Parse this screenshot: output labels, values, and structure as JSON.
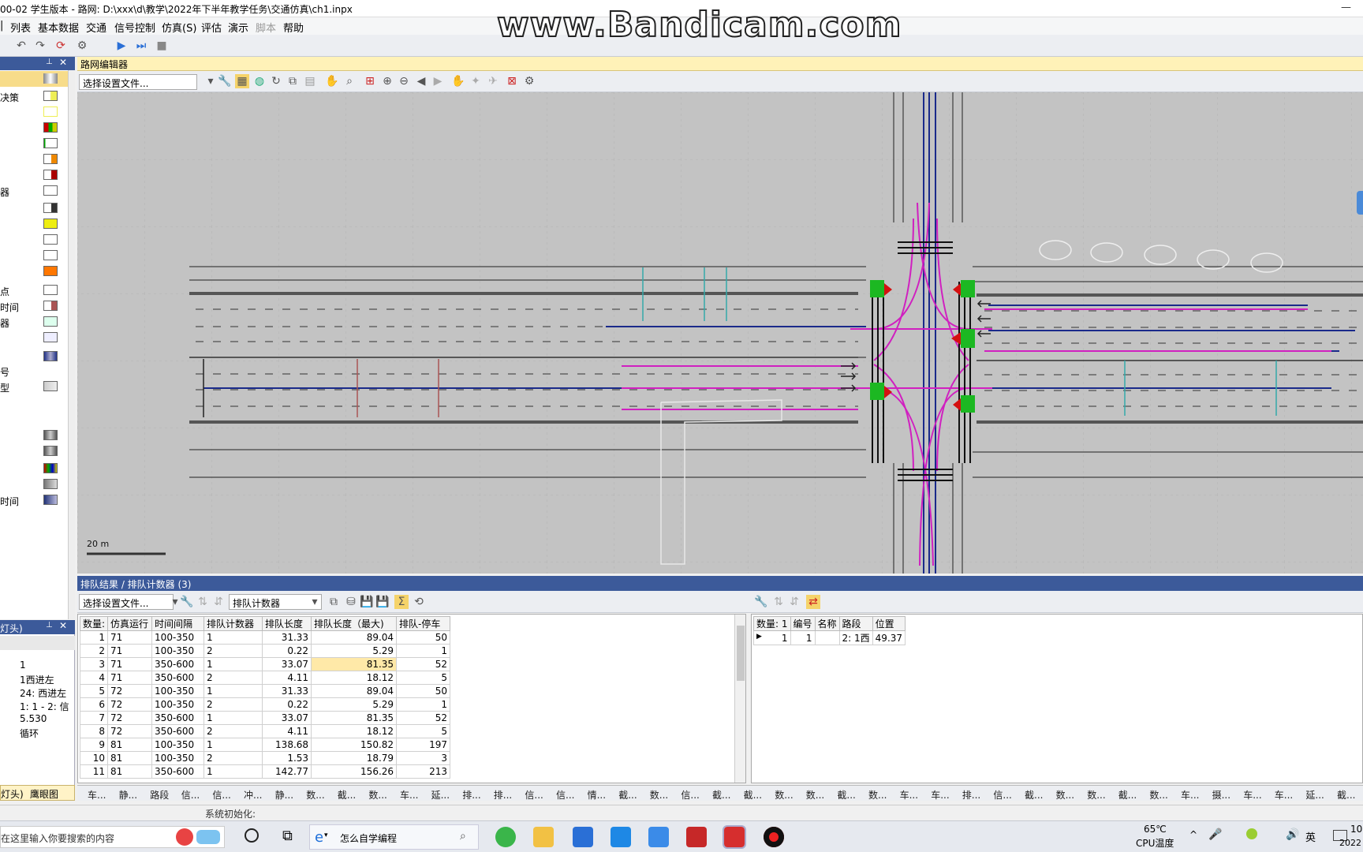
{
  "app": {
    "title": "00-02 学生版本 - 路网: D:\\xxx\\d\\教学\\2022年下半年教学任务\\交通仿真\\ch1.inpx",
    "watermark": "www.Bandicam.com"
  },
  "menu": [
    "列表",
    "基本数据",
    "交通",
    "信号控制",
    "仿真(S)",
    "评估",
    "演示",
    "脚本",
    "帮助"
  ],
  "left_panel": {
    "items": [
      "决策",
      "",
      "",
      "",
      "",
      "",
      "器",
      "",
      "",
      "",
      "",
      "",
      "点",
      "时间",
      "器",
      "",
      "",
      "号",
      "型",
      "",
      "",
      "",
      "",
      "",
      "",
      "时间"
    ]
  },
  "left_panel2": {
    "title": "灯头)",
    "values": [
      "1",
      "1西进左",
      "24: 西进左",
      "1: 1 - 2: 信",
      "5.530",
      "循环"
    ]
  },
  "editor": {
    "title": "路网编辑器",
    "config_select": "选择设置文件...",
    "scale_label": "20 m"
  },
  "results": {
    "title": "排队结果 / 排队计数器 (3)",
    "config_select": "选择设置文件...",
    "counter_select": "排队计数器",
    "columns": [
      "数量:",
      "仿真运行",
      "时间间隔",
      "排队计数器",
      "排队长度",
      "排队长度（最大)",
      "排队-停车"
    ],
    "rows": [
      [
        "1",
        "71",
        "100-350",
        "1",
        "31.33",
        "89.04",
        "50"
      ],
      [
        "2",
        "71",
        "100-350",
        "2",
        "0.22",
        "5.29",
        "1"
      ],
      [
        "3",
        "71",
        "350-600",
        "1",
        "33.07",
        "81.35",
        "52"
      ],
      [
        "4",
        "71",
        "350-600",
        "2",
        "4.11",
        "18.12",
        "5"
      ],
      [
        "5",
        "72",
        "100-350",
        "1",
        "31.33",
        "89.04",
        "50"
      ],
      [
        "6",
        "72",
        "100-350",
        "2",
        "0.22",
        "5.29",
        "1"
      ],
      [
        "7",
        "72",
        "350-600",
        "1",
        "33.07",
        "81.35",
        "52"
      ],
      [
        "8",
        "72",
        "350-600",
        "2",
        "4.11",
        "18.12",
        "5"
      ],
      [
        "9",
        "81",
        "100-350",
        "1",
        "138.68",
        "150.82",
        "197"
      ],
      [
        "10",
        "81",
        "100-350",
        "2",
        "1.53",
        "18.79",
        "3"
      ],
      [
        "11",
        "81",
        "350-600",
        "1",
        "142.77",
        "156.26",
        "213"
      ]
    ]
  },
  "counters": {
    "columns": [
      "数量: 1",
      "编号",
      "名称",
      "路段",
      "位置"
    ],
    "rows": [
      [
        "1",
        "1",
        "",
        "2: 1西",
        "49.37"
      ]
    ]
  },
  "bottom_tabs": [
    "车...",
    "静...",
    "路段",
    "信...",
    "信...",
    "冲...",
    "静...",
    "数...",
    "截...",
    "数...",
    "车...",
    "延...",
    "排...",
    "排...",
    "信...",
    "信...",
    "情...",
    "截...",
    "数...",
    "信...",
    "截...",
    "截...",
    "数...",
    "数...",
    "截...",
    "数...",
    "车...",
    "车...",
    "排...",
    "信...",
    "截...",
    "数...",
    "数...",
    "截...",
    "数...",
    "车...",
    "摄...",
    "车...",
    "车...",
    "延...",
    "截..."
  ],
  "left_tabs": [
    "灯头)",
    "鹰眼图"
  ],
  "status": "系统初始化:",
  "taskbar": {
    "search_placeholder": "在这里输入你要搜索的内容",
    "browser_tab": "怎么自学编程",
    "temp": "65℃",
    "temp_label": "CPU温度",
    "ime": "英",
    "clock_time": "10",
    "clock_date": "2022"
  }
}
